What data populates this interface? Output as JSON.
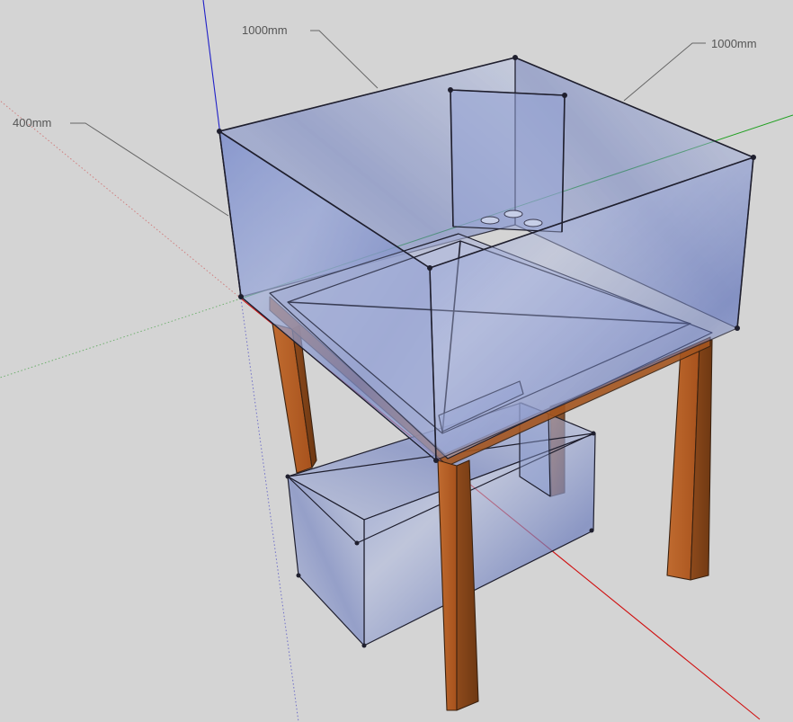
{
  "model": {
    "dimensions": [
      {
        "id": "front-width",
        "label": "1000mm"
      },
      {
        "id": "side-depth",
        "label": "1000mm"
      },
      {
        "id": "height",
        "label": "400mm"
      }
    ],
    "colors": {
      "background": "#d4d4d4",
      "glass": "#8b9bd0",
      "glass_dark": "#6f80bd",
      "wood": "#b8642c",
      "wood_dark": "#8a4519",
      "edge": "#1f1f2e",
      "axis_red": "#d01010",
      "axis_green": "#20a020",
      "axis_blue": "#2020c8"
    }
  }
}
